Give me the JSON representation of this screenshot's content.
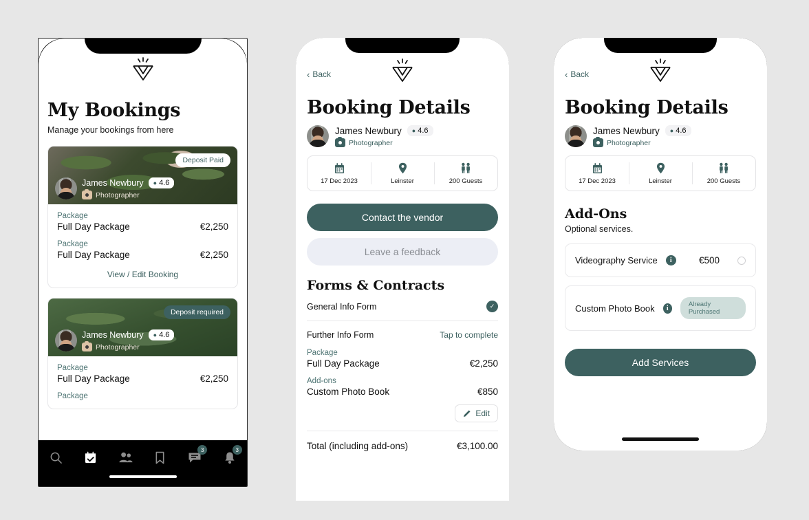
{
  "brand": {
    "logo_name": "wedding-diamond-w-logo",
    "accent": "#3d6160",
    "light_accent": "#cfdedb",
    "page_bg": "#e7e7e7"
  },
  "phone1": {
    "title": "My Bookings",
    "subtitle": "Manage your bookings from here",
    "cards": [
      {
        "badge": "Deposit Paid",
        "badge_style": "paid",
        "vendor": {
          "name": "James Newbury",
          "rating": "4.6",
          "role": "Photographer"
        },
        "lines": [
          {
            "group": "Package",
            "name": "Full Day Package",
            "price": "€2,250"
          },
          {
            "group": "Package",
            "name": "Full Day Package",
            "price": "€2,250"
          }
        ],
        "action": "View / Edit Booking"
      },
      {
        "badge": "Deposit required",
        "badge_style": "required",
        "vendor": {
          "name": "James Newbury",
          "rating": "4.6",
          "role": "Photographer"
        },
        "lines": [
          {
            "group": "Package",
            "name": "Full Day Package",
            "price": "€2,250"
          },
          {
            "group": "Package",
            "name": "",
            "price": ""
          }
        ],
        "action": ""
      }
    ],
    "nav": [
      {
        "icon": "search-icon",
        "badge": ""
      },
      {
        "icon": "calendar-check-icon",
        "badge": ""
      },
      {
        "icon": "people-icon",
        "badge": ""
      },
      {
        "icon": "bookmark-icon",
        "badge": ""
      },
      {
        "icon": "message-icon",
        "badge": "3"
      },
      {
        "icon": "bell-icon",
        "badge": "3"
      }
    ]
  },
  "phone2": {
    "back": "Back",
    "title": "Booking Details",
    "vendor": {
      "name": "James Newbury",
      "rating": "4.6",
      "role": "Photographer"
    },
    "facts": [
      {
        "icon": "calendar-icon",
        "label": "17 Dec 2023"
      },
      {
        "icon": "location-pin-icon",
        "label": "Leinster"
      },
      {
        "icon": "guests-icon",
        "label": "200 Guests"
      }
    ],
    "primary_button": "Contact the vendor",
    "ghost_button": "Leave a feedback",
    "forms_title": "Forms & Contracts",
    "forms": [
      {
        "label": "General Info Form",
        "status": "complete",
        "action": ""
      },
      {
        "label": "Further Info Form",
        "status": "pending",
        "action": "Tap to complete"
      }
    ],
    "lines": [
      {
        "group": "Package",
        "name": "Full Day Package",
        "price": "€2,250"
      },
      {
        "group": "Add-ons",
        "name": "Custom Photo Book",
        "price": "€850"
      }
    ],
    "edit_button": "Edit",
    "total_label": "Total (including add-ons)",
    "total_value": "€3,100.00"
  },
  "phone3": {
    "back": "Back",
    "title": "Booking Details",
    "vendor": {
      "name": "James Newbury",
      "rating": "4.6",
      "role": "Photographer"
    },
    "facts": [
      {
        "icon": "calendar-icon",
        "label": "17 Dec 2023"
      },
      {
        "icon": "location-pin-icon",
        "label": "Leinster"
      },
      {
        "icon": "guests-icon",
        "label": "200 Guests"
      }
    ],
    "addons_title": "Add-Ons",
    "addons_sub": "Optional services.",
    "addons": [
      {
        "name": "Videography Service",
        "price": "€500",
        "state": "selectable",
        "pill": ""
      },
      {
        "name": "Custom Photo Book",
        "price": "",
        "state": "purchased",
        "pill": "Already Purchased"
      }
    ],
    "cta": "Add Services"
  }
}
